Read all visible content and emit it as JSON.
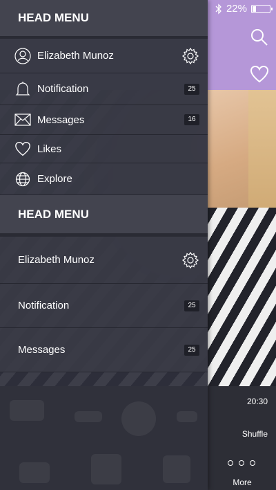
{
  "status": {
    "battery_percent": "22%",
    "battery_level": 0.22
  },
  "drawer": {
    "head_top": "HEAD MENU",
    "profile_name": "Elizabeth Munoz",
    "menu": [
      {
        "label": "Notification",
        "badge": "25"
      },
      {
        "label": "Messages",
        "badge": "16"
      },
      {
        "label": "Likes"
      },
      {
        "label": "Explore"
      }
    ],
    "head_second": "HEAD MENU",
    "profile_name_2": "Elizabeth Munoz",
    "menu_2": [
      {
        "label": "Notification",
        "badge": "25"
      },
      {
        "label": "Messages",
        "badge": "25"
      }
    ]
  },
  "player": {
    "time": "20:30",
    "shuffle": "Shuffle",
    "more": "More"
  },
  "icons": [
    "bluetooth-icon",
    "battery-icon",
    "search-icon",
    "heart-icon",
    "user-icon",
    "gear-icon",
    "bell-icon",
    "envelope-icon",
    "globe-icon"
  ],
  "colors": {
    "drawer_bg": "#2e2f3b",
    "header_bg": "#43444f",
    "accent_purple": "#b597d8",
    "badge_bg": "#1f2028"
  }
}
